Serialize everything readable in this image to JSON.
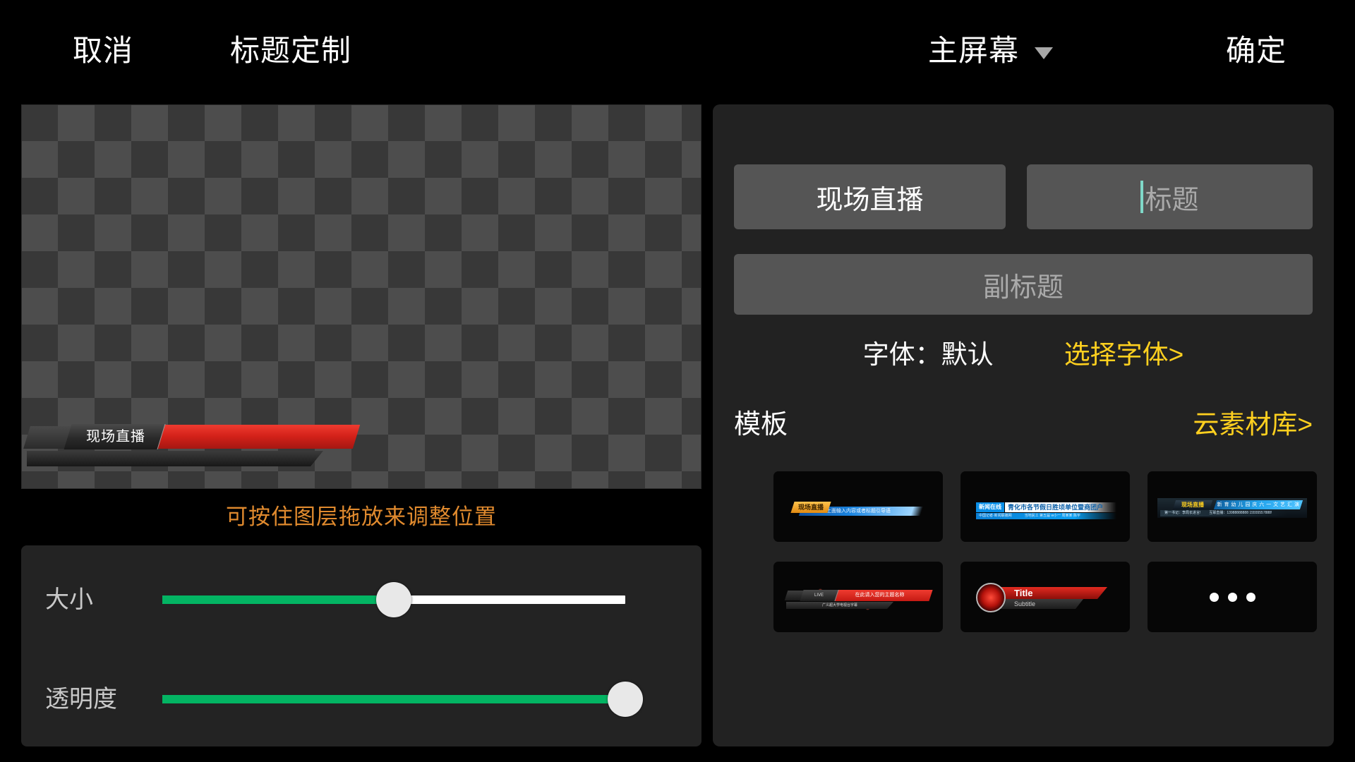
{
  "topbar": {
    "cancel": "取消",
    "title": "标题定制",
    "screen": "主屏幕",
    "confirm": "确定"
  },
  "canvas": {
    "overlay_tag": "现场直播",
    "hint": "可按住图层拖放来调整位置"
  },
  "sliders": {
    "size": {
      "label": "大小",
      "value": 50,
      "fill_color": "#03b463",
      "track_color": "#ffffff"
    },
    "opacity": {
      "label": "透明度",
      "value": 100,
      "fill_color": "#03b463",
      "track_color": "#ffffff"
    }
  },
  "panel": {
    "main_field_value": "现场直播",
    "title_field_placeholder": "标题",
    "subtitle_field_placeholder": "副标题",
    "font_current": "字体：默认",
    "font_select": "选择字体>",
    "templates_label": "模板",
    "cloud_library": "云素材库>",
    "accent_yellow": "#ffd01f",
    "cursor_color": "#7fd8c8"
  },
  "templates": [
    {
      "name": "orange-blue-lower-third",
      "tag": "现场直播",
      "line1": "在上面输入内容或者标题引导语"
    },
    {
      "name": "blue-white-news-bar",
      "tag": "新闻在线",
      "line1": "青化市各节假日胜顷单位暨商团户",
      "sub_left": "中国记者·新闻联播网",
      "sub_right": "当地民工 第五届 w小一 周某某  陈宇"
    },
    {
      "name": "dark-blue-glow-bar",
      "tag": "现场直播",
      "line1": "新 育 幼 儿 园 庆 六 一 文 艺 汇 演",
      "sub_left": "第一书记：李局长进言!",
      "sub_right": "互联直播：13988888888    15555557888!"
    },
    {
      "name": "red-lower-third",
      "tag": "LIVE",
      "line1": "在此请入您的主题名称",
      "sub": "广义超大学电视台字幕"
    },
    {
      "name": "red-circle-title",
      "title": "Title",
      "subtitle": "Subtitle"
    },
    {
      "name": "more-templates",
      "dots": 3
    }
  ]
}
